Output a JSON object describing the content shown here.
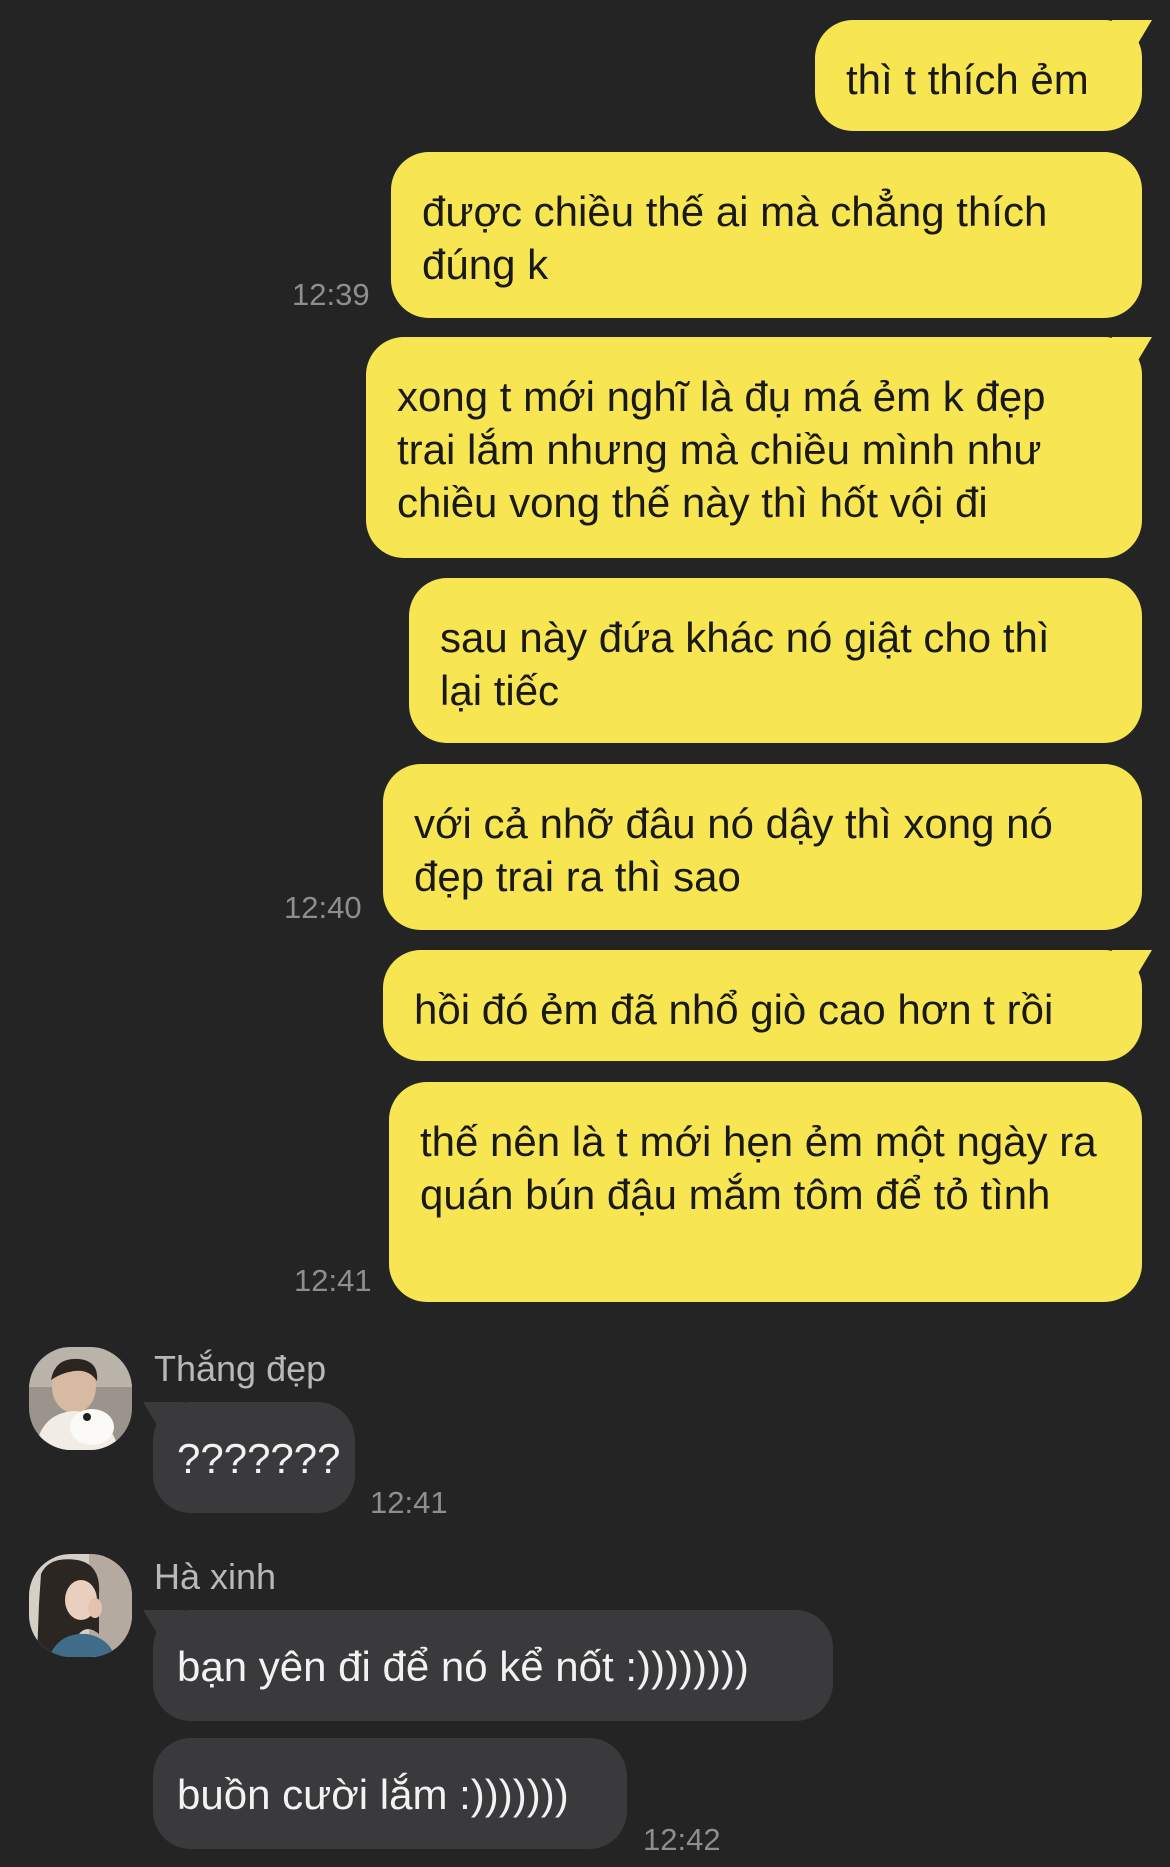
{
  "colors": {
    "background": "#242424",
    "outgoing_bubble": "#f7e652",
    "incoming_bubble": "#3a3a3c",
    "timestamp": "#8e8e8f"
  },
  "outgoing": [
    {
      "text": "thì t thích ẻm",
      "time": ""
    },
    {
      "text": "được chiều thế ai mà chẳng thích đúng k",
      "time": "12:39"
    },
    {
      "text": "xong t mới nghĩ là đụ má ẻm k đẹp trai lắm nhưng mà chiều mình như chiều vong thế này thì hốt vội đi",
      "time": ""
    },
    {
      "text": "sau này đứa khác nó giật cho thì lại tiếc",
      "time": ""
    },
    {
      "text": "với cả nhỡ đâu nó dậy thì xong nó đẹp trai ra thì sao",
      "time": "12:40"
    },
    {
      "text": "hồi đó ẻm đã nhổ giò cao hơn t rồi",
      "time": ""
    },
    {
      "text": "thế nên là t mới hẹn ẻm một ngày ra quán bún đậu mắm tôm để tỏ tình",
      "time": "12:41"
    }
  ],
  "incoming": [
    {
      "sender": "Thắng đẹp",
      "avatar": "avatar-photo-man",
      "messages": [
        {
          "text": "???????"
        }
      ],
      "time": "12:41"
    },
    {
      "sender": "Hà xinh",
      "avatar": "avatar-photo-woman",
      "messages": [
        {
          "text": "bạn yên đi để nó kể nốt :))))))))"
        },
        {
          "text": "buồn cười lắm :)))))))"
        }
      ],
      "time": "12:42"
    }
  ]
}
